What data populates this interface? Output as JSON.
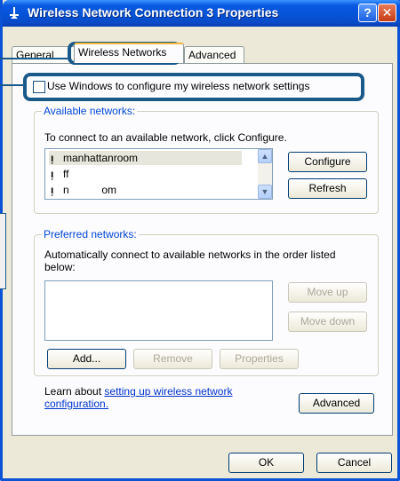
{
  "window": {
    "title": "Wireless Network Connection 3 Properties",
    "help_label": "?",
    "close_label": "✕"
  },
  "tabs": [
    {
      "label": "General"
    },
    {
      "label": "Wireless Networks"
    },
    {
      "label": "Advanced"
    }
  ],
  "use_windows_checkbox": {
    "label": "Use Windows to configure my wireless network settings",
    "checked": false
  },
  "available": {
    "group_label": "Available networks:",
    "instruction": "To connect to an available network, click Configure.",
    "networks": [
      {
        "name": "manhattanroom"
      },
      {
        "name": "ff"
      },
      {
        "name": "n           om"
      }
    ],
    "configure_label": "Configure",
    "refresh_label": "Refresh"
  },
  "preferred": {
    "group_label": "Preferred networks:",
    "instruction": "Automatically connect to available networks in the order listed below:",
    "move_up_label": "Move up",
    "move_down_label": "Move down",
    "add_label": "Add...",
    "remove_label": "Remove",
    "properties_label": "Properties"
  },
  "learn": {
    "prefix": "Learn about",
    "link_line1": "setting up wireless network",
    "link_line2": "configuration.",
    "advanced_label": "Advanced"
  },
  "footer": {
    "ok_label": "OK",
    "cancel_label": "Cancel"
  }
}
